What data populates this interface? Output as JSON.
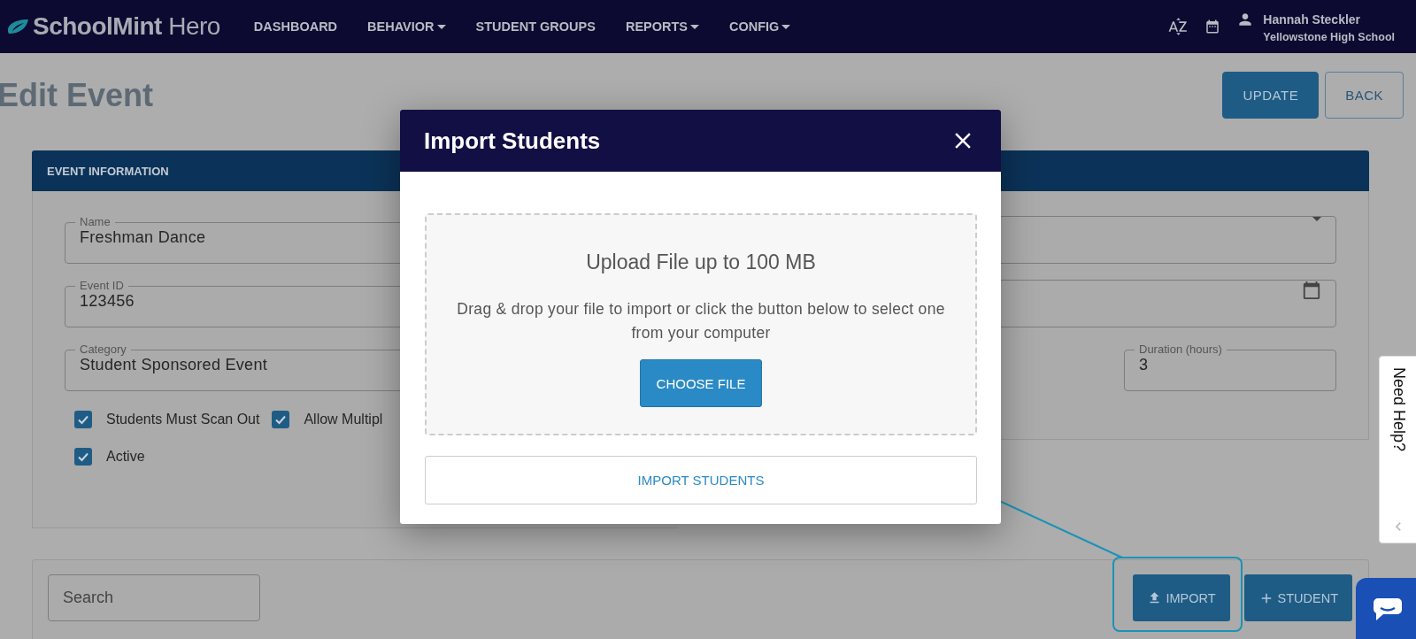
{
  "nav": {
    "logo": "**SchoolMint** Hero",
    "items": [
      {
        "label": "DASHBOARD",
        "has_menu": false
      },
      {
        "label": "BEHAVIOR",
        "has_menu": true
      },
      {
        "label": "STUDENT GROUPS",
        "has_menu": false
      },
      {
        "label": "REPORTS",
        "has_menu": true
      },
      {
        "label": "CONFIG",
        "has_menu": true
      }
    ],
    "user": {
      "name": "Hannah Steckler",
      "school": "Yellowstone High School"
    }
  },
  "page": {
    "title": "Edit Event",
    "actions": [
      {
        "label": "UPDATE",
        "kind": "primary"
      },
      {
        "label": "BACK",
        "kind": "outline"
      }
    ]
  },
  "event_card": {
    "header": "EVENT INFORMATION",
    "fields": [
      {
        "label": "Name",
        "value": "Freshman Dance"
      },
      {
        "label": "Event ID",
        "value": "123456"
      },
      {
        "label": "Category",
        "value": "Student Sponsored Event"
      }
    ],
    "checkboxes": [
      {
        "label": "Students Must Scan Out",
        "checked": true
      },
      {
        "label": "Allow Multipl",
        "checked": true
      },
      {
        "label": "Active",
        "checked": true
      }
    ],
    "right_fields": [
      {
        "kind": "select"
      },
      {
        "kind": "date"
      },
      {
        "kind": "text",
        "label": "Duration (hours)",
        "value": "3"
      }
    ]
  },
  "students": {
    "search_placeholder": "Search",
    "buttons": [
      {
        "label": "IMPORT",
        "kind": "import",
        "highlighted": true
      },
      {
        "label": "STUDENT",
        "kind": "add",
        "highlighted": false
      }
    ]
  },
  "modal": {
    "title": "Import Students",
    "drop_title": "Upload File up to 100 MB",
    "drop_text": "Drag & drop your file to import or click the button below to select one from your computer",
    "choose_button": "CHOOSE FILE",
    "import_button": "IMPORT STUDENTS"
  },
  "help_tab": {
    "label": "Need Help?"
  }
}
